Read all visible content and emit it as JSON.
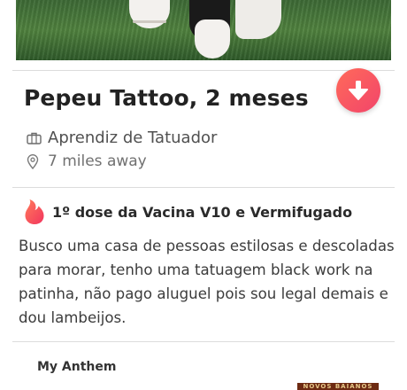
{
  "profile": {
    "name_age": "Pepeu Tattoo, 2 meses",
    "job": "Aprendiz de Tatuador",
    "distance": "7 miles away"
  },
  "highlight": {
    "text": "1º dose da Vacina V10 e Vermifugado",
    "icon": "flame-icon"
  },
  "bio": "Busco uma casa de pessoas estilosas e descoladas para morar, tenho uma tatuagem black work na patinha, não pago aluguel pois sou legal demais e dou lambeijos.",
  "anthem": {
    "heading": "My Anthem",
    "album_text": "NOVOS BAIANOS"
  },
  "fab": {
    "icon": "arrow-down-icon"
  },
  "colors": {
    "accent_start": "#ff6a5a",
    "accent_end": "#f2456a",
    "text_primary": "#222222",
    "text_secondary": "#707070"
  }
}
